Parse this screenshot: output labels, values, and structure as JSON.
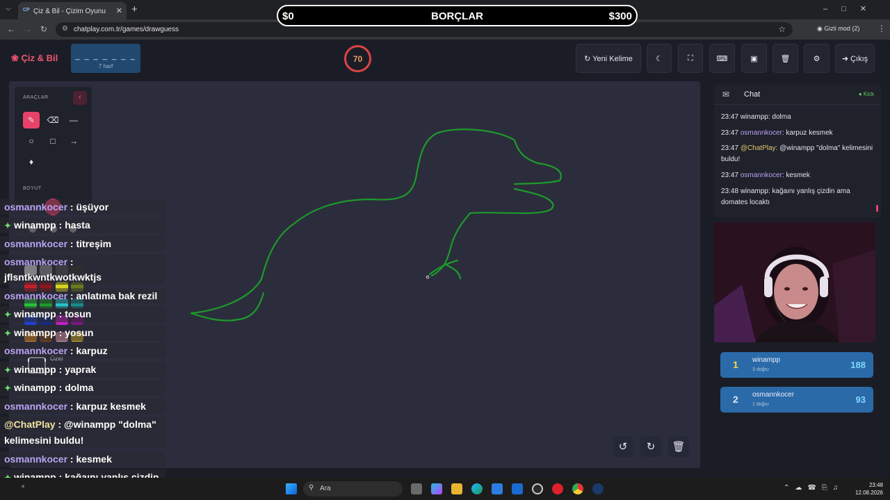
{
  "browser": {
    "tab_title": "Çiz & Bil - Çizim Oyunu",
    "tab_favicon": "CP",
    "url": "chatplay.com.tr/games/drawguess",
    "incognito_label": "Gizli mod (2)"
  },
  "banner": {
    "left_amount": "$0",
    "title": "BORÇLAR",
    "right_amount": "$300"
  },
  "header": {
    "logo": "Çiz & Bil",
    "word_blanks": "_ _ _ _ _ _ _",
    "word_hint": "7 harf",
    "timer": "70",
    "new_word_label": "Yeni Kelime",
    "exit_label": "Çıkış"
  },
  "tools": {
    "title": "ARAÇLAR",
    "size_label": "BOYUT",
    "custom_label": "Özel"
  },
  "overlay_chat": [
    {
      "user": "osmannkocer",
      "msg": "üşüyor",
      "gem": false
    },
    {
      "user": "winampp",
      "msg": "hasta",
      "gem": true
    },
    {
      "user": "osmannkocer",
      "msg": "titreşim",
      "gem": false
    },
    {
      "user": "osmannkocer",
      "msg": "",
      "gem": false
    },
    {
      "user": "",
      "msg": "jflsntkwntkwotkwktjs",
      "gem": false
    },
    {
      "user": "osmannkocer",
      "msg": "anlatıma bak rezil",
      "gem": false
    },
    {
      "user": "winampp",
      "msg": "tosun",
      "gem": true
    },
    {
      "user": "winampp",
      "msg": "yosun",
      "gem": true
    },
    {
      "user": "osmannkocer",
      "msg": "karpuz",
      "gem": false
    },
    {
      "user": "winampp",
      "msg": "yaprak",
      "gem": true
    },
    {
      "user": "winampp",
      "msg": "dolma",
      "gem": true
    },
    {
      "user": "osmannkocer",
      "msg": "karpuz kesmek",
      "gem": false
    },
    {
      "user": "@ChatPlay",
      "msg": "@winampp \"dolma\"",
      "gem": false
    },
    {
      "user": "",
      "msg": "kelimesini buldu!",
      "gem": false
    },
    {
      "user": "osmannkocer",
      "msg": "kesmek",
      "gem": false
    },
    {
      "user": "winampp",
      "msg": "kağaını yanlış çizdin",
      "gem": true
    },
    {
      "user": "",
      "msg": "ama domates locaktı",
      "gem": false
    }
  ],
  "chat": {
    "title": "Chat",
    "platform": "Kick",
    "messages": [
      {
        "time": "23:47",
        "user": "winampp",
        "text": "dolma",
        "kind": "plain"
      },
      {
        "time": "23:47",
        "user": "osmannkocer",
        "text": "karpuz kesmek",
        "kind": "user"
      },
      {
        "time": "23:47",
        "user": "@ChatPlay",
        "text": "@winampp \"dolma\" kelimesini buldu!",
        "kind": "bot"
      },
      {
        "time": "23:47",
        "user": "osmannkocer",
        "text": "kesmek",
        "kind": "user"
      },
      {
        "time": "23:48",
        "user": "winampp",
        "text": "kağaını yanlış çizdin ama domates locaktı",
        "kind": "plain"
      }
    ]
  },
  "leaderboard": [
    {
      "rank": "1",
      "name": "winampp",
      "sub": "3 doğru",
      "score": "188",
      "rank_color": "#f5d742"
    },
    {
      "rank": "2",
      "name": "osmannkocer",
      "sub": "1 doğru",
      "score": "93",
      "rank_color": "#dfe6ee"
    }
  ],
  "taskbar": {
    "search_placeholder": "Ara",
    "time": "23:48",
    "date": "12.08.2026"
  },
  "colors": {
    "accent": "#f05670",
    "stroke": "#1e9a2a",
    "canvas_bg": "#2b2d3c",
    "panel_bg": "#1f212b",
    "leader_bg": "#2a6aa8"
  }
}
